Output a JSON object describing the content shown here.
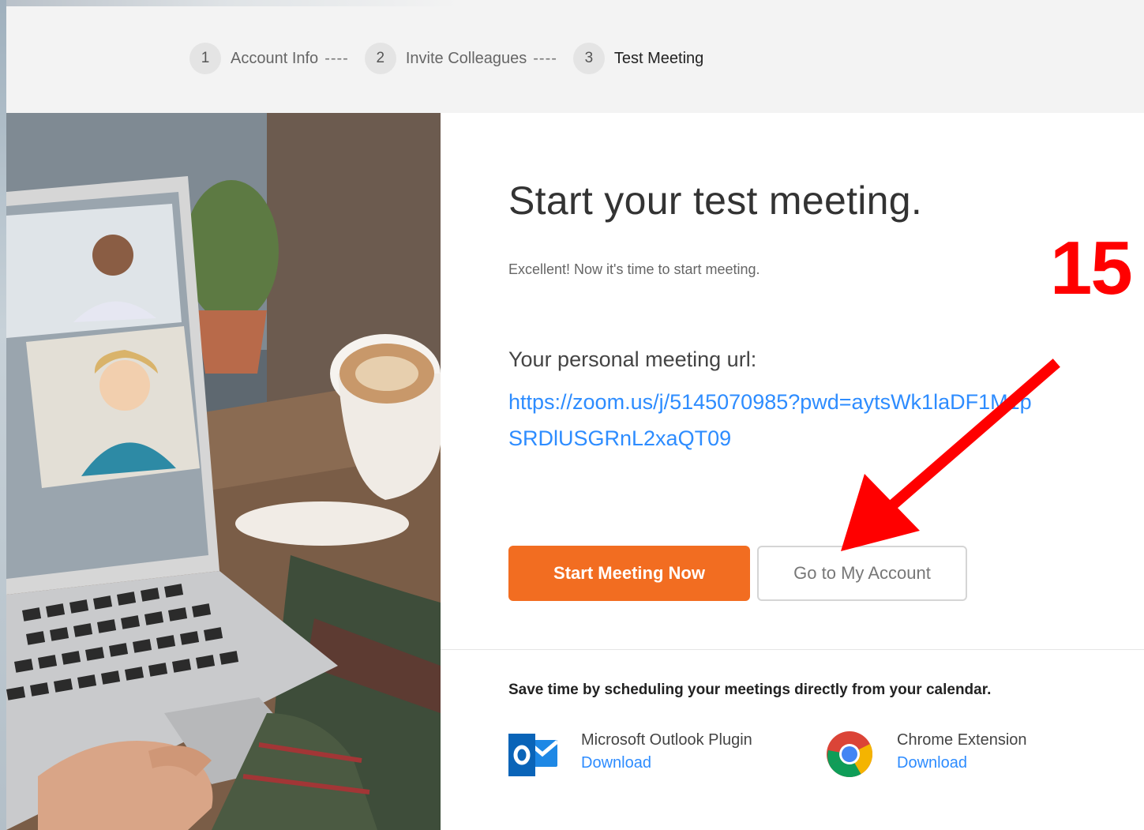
{
  "steps": [
    {
      "number": "1",
      "label": "Account Info",
      "separator": "----"
    },
    {
      "number": "2",
      "label": "Invite Colleagues",
      "separator": "----"
    },
    {
      "number": "3",
      "label": "Test Meeting"
    }
  ],
  "main": {
    "headline": "Start your test meeting.",
    "subtext": "Excellent! Now it's time to start meeting.",
    "url_label": "Your personal meeting url:",
    "url": "https://zoom.us/j/5145070985?pwd=aytsWk1laDF1M1pSRDlUSGRnL2xaQT09",
    "primary_button": "Start Meeting Now",
    "secondary_button": "Go to My Account"
  },
  "calendar": {
    "text": "Save time by scheduling your meetings directly from your calendar.",
    "plugins": [
      {
        "title": "Microsoft Outlook Plugin",
        "link": "Download",
        "icon": "outlook-icon"
      },
      {
        "title": "Chrome Extension",
        "link": "Download",
        "icon": "chrome-icon"
      }
    ]
  },
  "annotation": {
    "number": "15",
    "color": "#ff0000"
  },
  "colors": {
    "accent_orange": "#f26d21",
    "link_blue": "#2d8cff"
  }
}
